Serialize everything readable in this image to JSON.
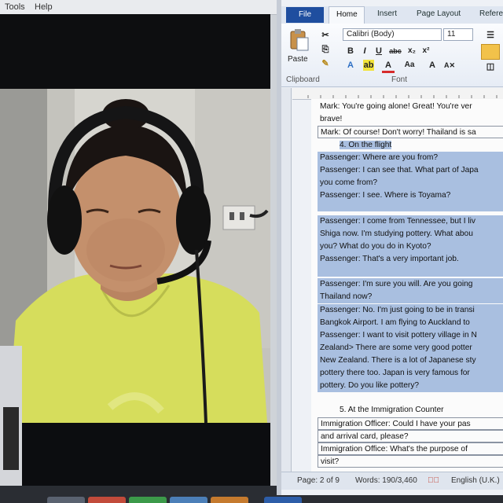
{
  "video_window": {
    "menu": [
      "Tools",
      "Help"
    ]
  },
  "word": {
    "tabs": {
      "file": "File",
      "home": "Home",
      "insert": "Insert",
      "page_layout": "Page Layout",
      "references": "Refere"
    },
    "ribbon": {
      "paste_label": "Paste",
      "font_name": "Calibri (Body)",
      "font_size": "11",
      "clipboard_group": "Clipboard",
      "font_group": "Font",
      "bold": "B",
      "italic": "I",
      "underline": "U",
      "strike": "abc",
      "subscript": "x₂",
      "superscript": "x²",
      "grow_font": "A",
      "shrink_font": "Aa"
    },
    "document_lines": [
      {
        "text": "Mark: You're going alone! Great! You're ver",
        "style": "plain"
      },
      {
        "text": "brave!",
        "style": "plain"
      },
      {
        "text": "Mark: Of course! Don't worry! Thailand is sa",
        "style": "boxed"
      },
      {
        "text": "4.   On the flight",
        "style": "heading"
      },
      {
        "text": "Passenger: Where are you from?",
        "style": "hl"
      },
      {
        "text": "Passenger: I can see that. What part of Japa",
        "style": "hl"
      },
      {
        "text": "you come from?",
        "style": "hl"
      },
      {
        "text": "Passenger: I see. Where is Toyama?",
        "style": "hl"
      },
      {
        "text": "",
        "style": "hl"
      },
      {
        "text": "Passenger: I come from Tennessee, but I liv",
        "style": "hl"
      },
      {
        "text": "Shiga now. I'm studying pottery. What abou",
        "style": "hl"
      },
      {
        "text": "you? What do you do in Kyoto?",
        "style": "hl"
      },
      {
        "text": "Passenger: That's a very important job.",
        "style": "hl"
      },
      {
        "text": "",
        "style": "hl"
      },
      {
        "text": "Passenger: I'm sure you will. Are you going",
        "style": "hl"
      },
      {
        "text": "Thailand now?",
        "style": "hl"
      },
      {
        "text": "Passenger: No. I'm just going to be in transi",
        "style": "hl"
      },
      {
        "text": "Bangkok Airport. I am flying to Auckland to",
        "style": "hl"
      },
      {
        "text": "Passenger: I want to visit pottery village in N",
        "style": "hl"
      },
      {
        "text": "Zealand> There are some very good potter",
        "style": "hl"
      },
      {
        "text": "New Zealand. There is a lot of Japanese sty",
        "style": "hl"
      },
      {
        "text": "pottery there too. Japan is very famous for",
        "style": "hl"
      },
      {
        "text": "pottery. Do you like pottery?",
        "style": "hl"
      },
      {
        "text": "",
        "style": "plain"
      },
      {
        "text": "5.   At the Immigration Counter",
        "style": "numbered"
      },
      {
        "text": "Immigration Officer: Could I have your pas",
        "style": "boxed"
      },
      {
        "text": "and arrival card, please?",
        "style": "boxed"
      },
      {
        "text": "Immigration Office: What's the purpose of",
        "style": "boxed"
      },
      {
        "text": "visit?",
        "style": "boxed"
      }
    ],
    "status": {
      "page": "Page: 2 of 9",
      "words": "Words: 190/3,460",
      "language": "English (U.K.)"
    }
  },
  "colors": {
    "file_tab": "#1f4e9f",
    "highlight": "#a9bfe0",
    "shirt": "#d8e05a"
  }
}
